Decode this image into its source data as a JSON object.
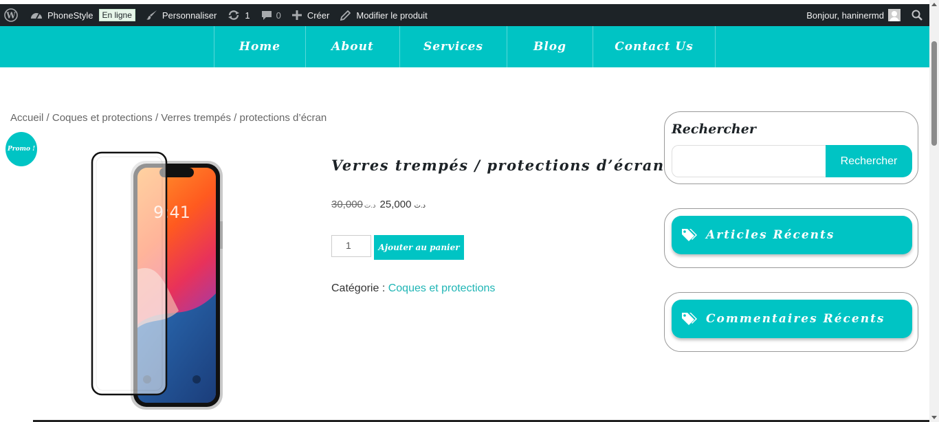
{
  "adminbar": {
    "site_name": "PhoneStyle",
    "status_badge": "En ligne",
    "customize": "Personnaliser",
    "updates_count": "1",
    "comments_count": "0",
    "create": "Créer",
    "edit_product": "Modifier le produit",
    "greeting": "Bonjour, haninermd",
    "icons": [
      "wordpress-icon",
      "dashboard-icon",
      "brush-icon",
      "updates-icon",
      "comment-icon",
      "plus-icon",
      "pencil-icon",
      "avatar",
      "search-icon"
    ]
  },
  "nav": {
    "items": [
      {
        "label": "Home"
      },
      {
        "label": "About"
      },
      {
        "label": "Services"
      },
      {
        "label": "Blog"
      },
      {
        "label": "Contact Us"
      }
    ]
  },
  "breadcrumb": "Accueil / Coques et protections / Verres trempés / protections d’écran",
  "promo_badge": "Promo !",
  "product": {
    "title": "Verres trempés / protections d’écran",
    "old_price": "30,000",
    "old_currency": "د.ت",
    "new_currency": "د.ت",
    "new_price": "25,000",
    "quantity": "1",
    "add_to_cart": "Ajouter au panier",
    "category_label": "Catégorie :",
    "category_link": "Coques et protections",
    "phone_time": "9:41"
  },
  "sidebar": {
    "search_title": "Rechercher",
    "search_button": "Rechercher",
    "recent_posts": "Articles Récents",
    "recent_comments": "Commentaires Récents"
  },
  "colors": {
    "accent": "#00c4c4",
    "adminbar": "#1d2327",
    "link": "#1fb5b5"
  }
}
